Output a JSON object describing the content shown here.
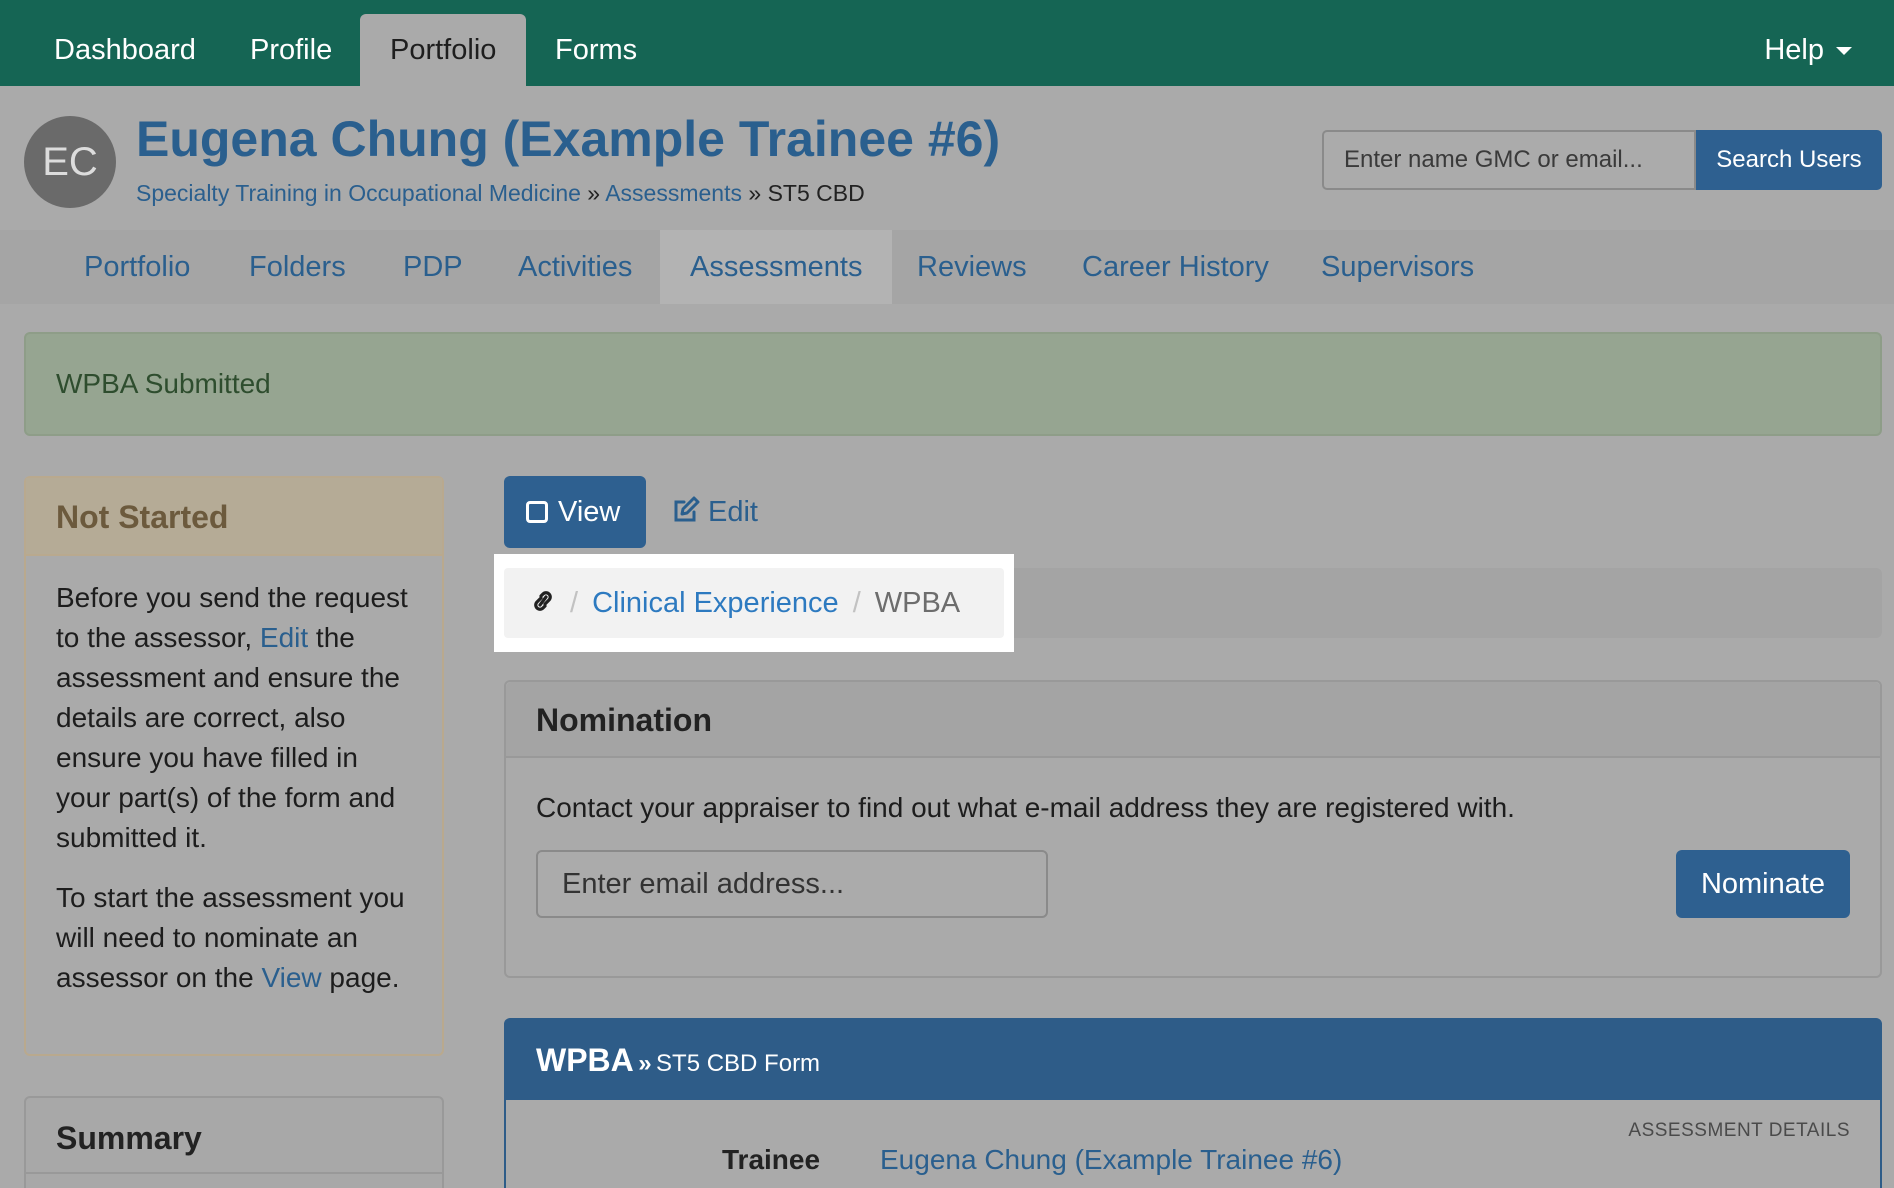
{
  "topnav": {
    "tabs": [
      "Dashboard",
      "Profile",
      "Portfolio",
      "Forms"
    ],
    "active": "Portfolio",
    "help_label": "Help"
  },
  "header": {
    "avatar_initials": "EC",
    "user_name": "Eugena Chung (Example Trainee #6)",
    "breadcrumb": {
      "programme": "Specialty Training in Occupational Medicine",
      "sep": "»",
      "section": "Assessments",
      "current": "ST5 CBD"
    },
    "search": {
      "placeholder": "Enter name GMC or email...",
      "button_label": "Search Users"
    }
  },
  "subnav": {
    "tabs": [
      "Portfolio",
      "Folders",
      "PDP",
      "Activities",
      "Assessments",
      "Reviews",
      "Career History",
      "Supervisors"
    ],
    "active": "Assessments"
  },
  "alert": {
    "message": "WPBA Submitted"
  },
  "status_panel": {
    "title": "Not Started",
    "p1_a": "Before you send the request to the assessor, ",
    "p1_link": "Edit",
    "p1_b": " the assessment and ensure the details are correct, also ensure you have filled in your part(s) of the form and submitted it.",
    "p2_a": "To start the assessment you will need to nominate an assessor on the ",
    "p2_link": "View",
    "p2_b": " page."
  },
  "summary_panel": {
    "title": "Summary"
  },
  "actions": {
    "view_label": "View",
    "edit_label": "Edit"
  },
  "form_breadcrumb": {
    "link": "Clinical Experience",
    "current": "WPBA",
    "sep": "/"
  },
  "nomination": {
    "title": "Nomination",
    "help_text": "Contact your appraiser to find out what e-mail address they are registered with.",
    "email_placeholder": "Enter email address...",
    "button_label": "Nominate"
  },
  "wpba_panel": {
    "title": "WPBA",
    "sep": "»",
    "subtitle": "ST5 CBD Form",
    "details_label": "ASSESSMENT DETAILS",
    "trainee_label": "Trainee",
    "trainee_value": "Eugena Chung (Example Trainee #6)"
  }
}
